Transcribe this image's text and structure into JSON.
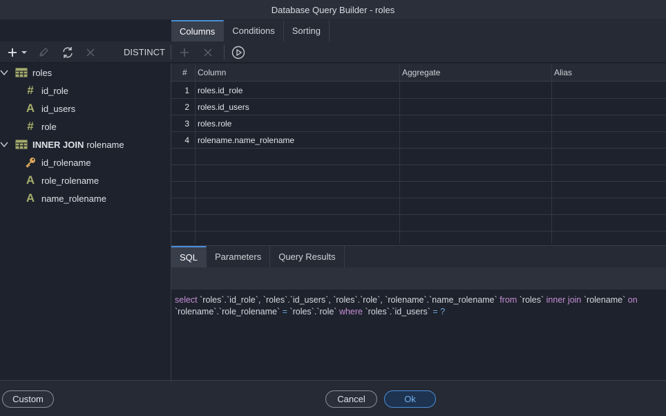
{
  "window": {
    "title": "Database Query Builder - roles"
  },
  "top_tabs": [
    {
      "label": "Columns",
      "active": true
    },
    {
      "label": "Conditions",
      "active": false
    },
    {
      "label": "Sorting",
      "active": false
    }
  ],
  "toolbar": {
    "add_icon": "plus-icon",
    "dropdown_icon": "chevron-down-icon",
    "edit_icon": "pencil-icon",
    "refresh_icon": "refresh-icon",
    "delete_icon": "close-icon",
    "distinct_label": "DISTINCT",
    "add_column_icon": "plus-icon",
    "remove_column_icon": "close-icon",
    "run_icon": "play-circle-icon"
  },
  "tree": {
    "tables": [
      {
        "label": "roles",
        "prefix": "",
        "fields": [
          {
            "name": "id_role",
            "icon": "#",
            "type": "number"
          },
          {
            "name": "id_users",
            "icon": "A",
            "type": "text"
          },
          {
            "name": "role",
            "icon": "#",
            "type": "number"
          }
        ]
      },
      {
        "label": "rolename",
        "prefix": "INNER JOIN",
        "fields": [
          {
            "name": "id_rolename",
            "icon": "key",
            "type": "key"
          },
          {
            "name": "role_rolename",
            "icon": "A",
            "type": "text"
          },
          {
            "name": "name_rolename",
            "icon": "A",
            "type": "text"
          }
        ]
      }
    ]
  },
  "grid": {
    "headers": [
      "#",
      "Column",
      "Aggregate",
      "Alias"
    ],
    "rows": [
      {
        "num": "1",
        "column": "roles.id_role",
        "aggregate": "",
        "alias": ""
      },
      {
        "num": "2",
        "column": "roles.id_users",
        "aggregate": "",
        "alias": ""
      },
      {
        "num": "3",
        "column": "roles.role",
        "aggregate": "",
        "alias": ""
      },
      {
        "num": "4",
        "column": "rolename.name_rolename",
        "aggregate": "",
        "alias": ""
      }
    ]
  },
  "bottom_tabs": [
    {
      "label": "SQL",
      "active": true
    },
    {
      "label": "Parameters",
      "active": false
    },
    {
      "label": "Query Results",
      "active": false
    }
  ],
  "sql": {
    "tokens": [
      {
        "t": "select",
        "k": "kw"
      },
      {
        "t": " `roles`.`id_role`, `roles`.`id_users`, `roles`.`role`, `rolename`.`name_rolename` ",
        "k": ""
      },
      {
        "t": "from",
        "k": "kw"
      },
      {
        "t": " `roles` ",
        "k": ""
      },
      {
        "t": "inner join",
        "k": "kw"
      },
      {
        "t": " `rolename` ",
        "k": ""
      },
      {
        "t": "on",
        "k": "kw"
      },
      {
        "t": " `rolename`.`role_rolename` ",
        "k": ""
      },
      {
        "t": "=",
        "k": "op"
      },
      {
        "t": " `roles`.`role` ",
        "k": ""
      },
      {
        "t": "where",
        "k": "kw"
      },
      {
        "t": " `roles`.`id_users` ",
        "k": ""
      },
      {
        "t": "=",
        "k": "op"
      },
      {
        "t": " ",
        "k": ""
      },
      {
        "t": "?",
        "k": "op"
      }
    ]
  },
  "footer": {
    "custom_label": "Custom",
    "cancel_label": "Cancel",
    "ok_label": "Ok"
  },
  "colors": {
    "accent": "#4a90d9",
    "keyword": "#c58fd6",
    "field_icon": "#a6ad6b",
    "key_icon": "#d9a55a"
  }
}
